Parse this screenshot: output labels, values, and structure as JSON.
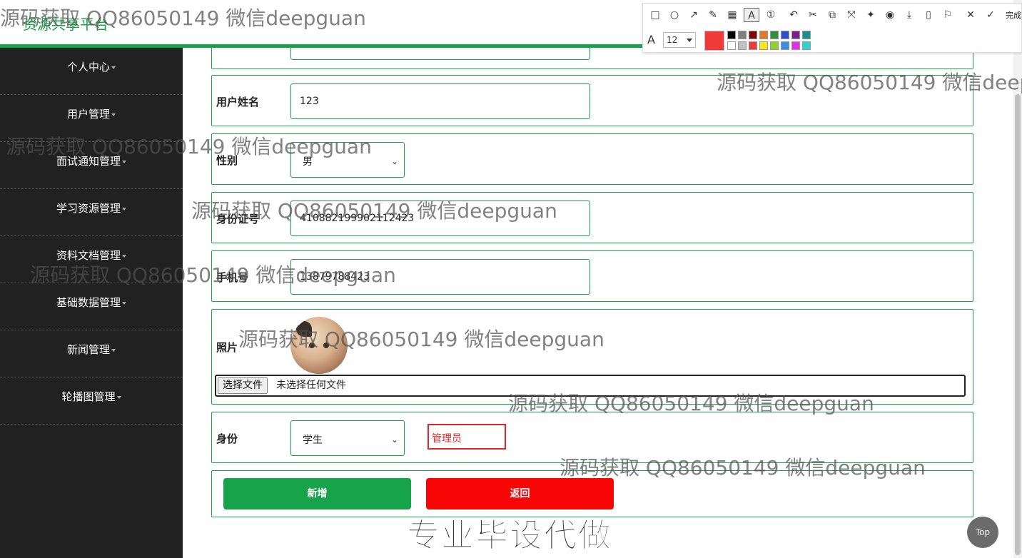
{
  "header": {
    "brand": "资源共享平台"
  },
  "sidebar": {
    "items": [
      {
        "label": "个人中心"
      },
      {
        "label": "用户管理"
      },
      {
        "label": "面试通知管理"
      },
      {
        "label": "学习资源管理"
      },
      {
        "label": "资料文档管理"
      },
      {
        "label": "基础数据管理"
      },
      {
        "label": "新闻管理"
      },
      {
        "label": "轮播图管理"
      }
    ]
  },
  "form": {
    "name": {
      "label": "用户姓名",
      "value": "123"
    },
    "gender": {
      "label": "性别",
      "value": "男"
    },
    "id_card": {
      "label": "身份证号",
      "value": "410882199902112423"
    },
    "phone": {
      "label": "手机号",
      "value": "13879788423"
    },
    "photo": {
      "label": "照片",
      "file_button": "选择文件",
      "file_status": "未选择任何文件"
    },
    "role": {
      "label": "身份",
      "value": "学生",
      "annotation": "管理员"
    },
    "buttons": {
      "add": "新增",
      "back": "返回"
    }
  },
  "top_button": "Top",
  "snip_toolbar": {
    "done_label": "完成",
    "font_size": "12",
    "main_color": "#ef3a3a",
    "palette": [
      "#000000",
      "#808080",
      "#800000",
      "#e07b2a",
      "#2f8f3c",
      "#2c4fcf",
      "#7a1f8a",
      "#17908f",
      "#ffffff",
      "#c0c0c0",
      "#ef3a3a",
      "#f5e814",
      "#8fd12a",
      "#3a8fe0",
      "#e62ee6",
      "#2bd3d3"
    ],
    "tools": [
      "rectangle-icon",
      "ellipse-icon",
      "arrow-icon",
      "pen-icon",
      "mosaic-icon",
      "text-icon",
      "number-icon",
      "undo-icon",
      "cut-icon",
      "ocr-icon",
      "resize-icon",
      "pin-icon",
      "record-icon",
      "download-icon",
      "phone-icon",
      "bookmark-icon",
      "close-icon",
      "check-icon"
    ]
  },
  "watermarks": {
    "text": "源码获取 QQ86050149 微信deepguan",
    "banner": "专业毕设代做"
  }
}
